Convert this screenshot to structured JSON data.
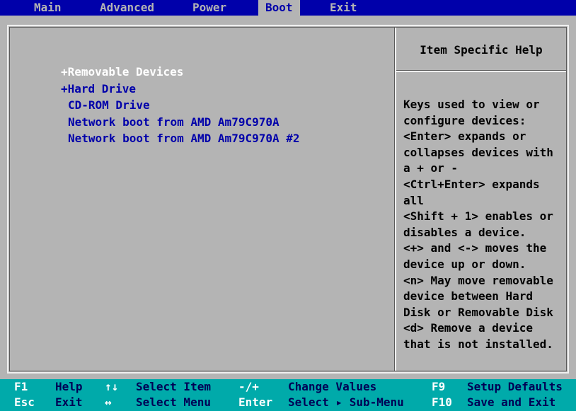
{
  "menu": {
    "items": [
      {
        "label": "Main"
      },
      {
        "label": "Advanced"
      },
      {
        "label": "Power"
      },
      {
        "label": "Boot"
      },
      {
        "label": "Exit"
      }
    ],
    "active": "Boot"
  },
  "boot": {
    "items": [
      {
        "label": "+Removable Devices",
        "selected": true
      },
      {
        "label": "+Hard Drive",
        "selected": false
      },
      {
        "label": "CD-ROM Drive",
        "selected": false
      },
      {
        "label": "Network boot from AMD Am79C970A",
        "selected": false
      },
      {
        "label": "Network boot from AMD Am79C970A #2",
        "selected": false
      }
    ]
  },
  "help": {
    "title": "Item Specific Help",
    "lines": [
      "Keys used to view or",
      "configure devices:",
      "<Enter> expands or",
      "collapses devices with",
      "a + or -",
      "<Ctrl+Enter> expands",
      "all",
      "<Shift + 1> enables or",
      "disables a device.",
      "<+> and <-> moves the",
      "device up or down.",
      "<n> May move removable",
      "device between Hard",
      "Disk or Removable Disk",
      "<d> Remove a device",
      "that is not installed."
    ]
  },
  "footer": {
    "row1": {
      "f1_key": "F1",
      "f1_desc": "Help",
      "updown_key": "↑↓",
      "updown_desc": "Select Item",
      "plusminus_key": "-/+",
      "plusminus_desc": "Change Values",
      "f9_key": "F9",
      "f9_desc": "Setup Defaults"
    },
    "row2": {
      "esc_key": "Esc",
      "esc_desc": "Exit",
      "leftright_key": "↔",
      "leftright_desc": "Select Menu",
      "enter_key": "Enter",
      "enter_desc": "Select ▸ Sub-Menu",
      "f10_key": "F10",
      "f10_desc": "Save and Exit"
    }
  },
  "colors": {
    "menubar_bg": "#0000aa",
    "body_bg": "#b4b4b4",
    "statusbar_bg": "#00aaaa",
    "selected_text": "#ffffff",
    "item_text": "#0000aa"
  }
}
